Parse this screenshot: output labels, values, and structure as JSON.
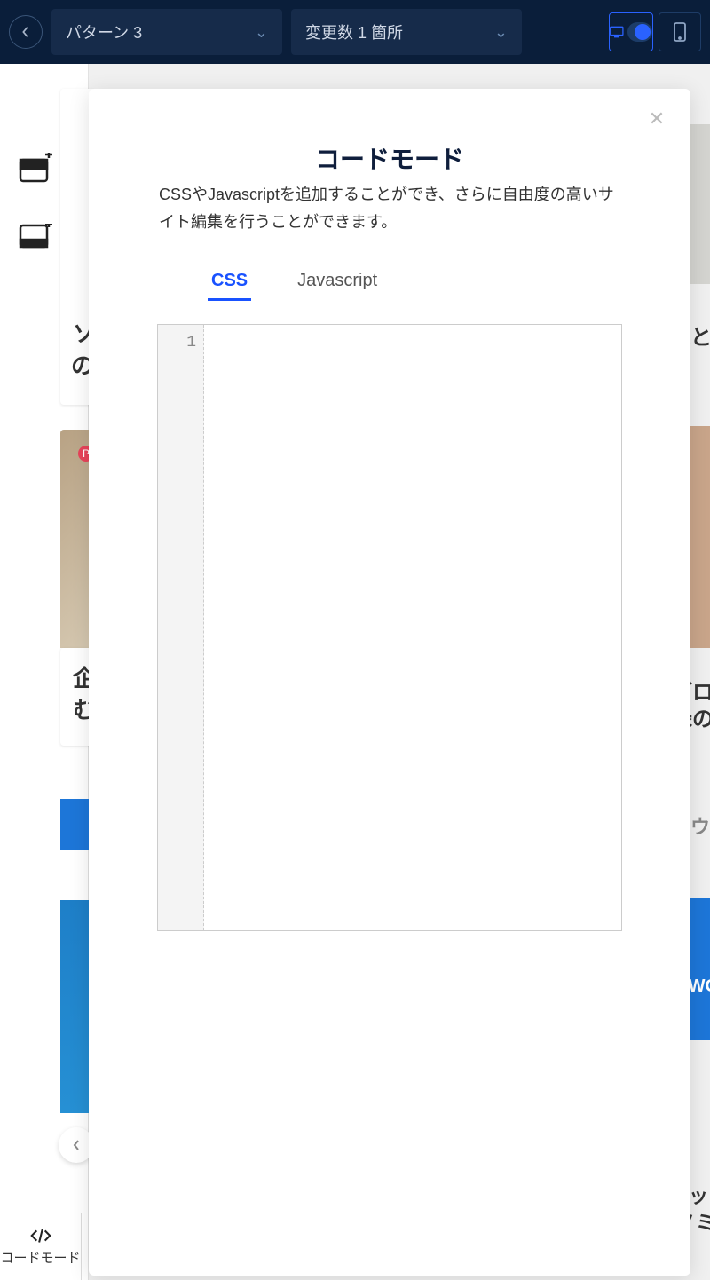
{
  "topbar": {
    "pattern_label": "パターン 3",
    "changes_label": "変更数 1 箇所"
  },
  "modal": {
    "title": "コードモード",
    "description": "CSSやJavascriptを追加することができ、さらに自由度の高いサイト編集を行うことができます。",
    "tabs": {
      "css": "CSS",
      "js": "Javascript"
    },
    "line_number": "1"
  },
  "bottom": {
    "code_mode_label": "コードモード"
  },
  "bg": {
    "left_text_1": "ソ",
    "left_text_2": "の",
    "left_text_3": "企",
    "left_text_4": "む",
    "right_text_1": "録と",
    "right_text_2": "ブロ",
    "right_text_3": "録の",
    "right_text_4": "ウ",
    "right_text_5": "WO",
    "right_text_6": "ッ",
    "right_text_7": "ノミ"
  }
}
